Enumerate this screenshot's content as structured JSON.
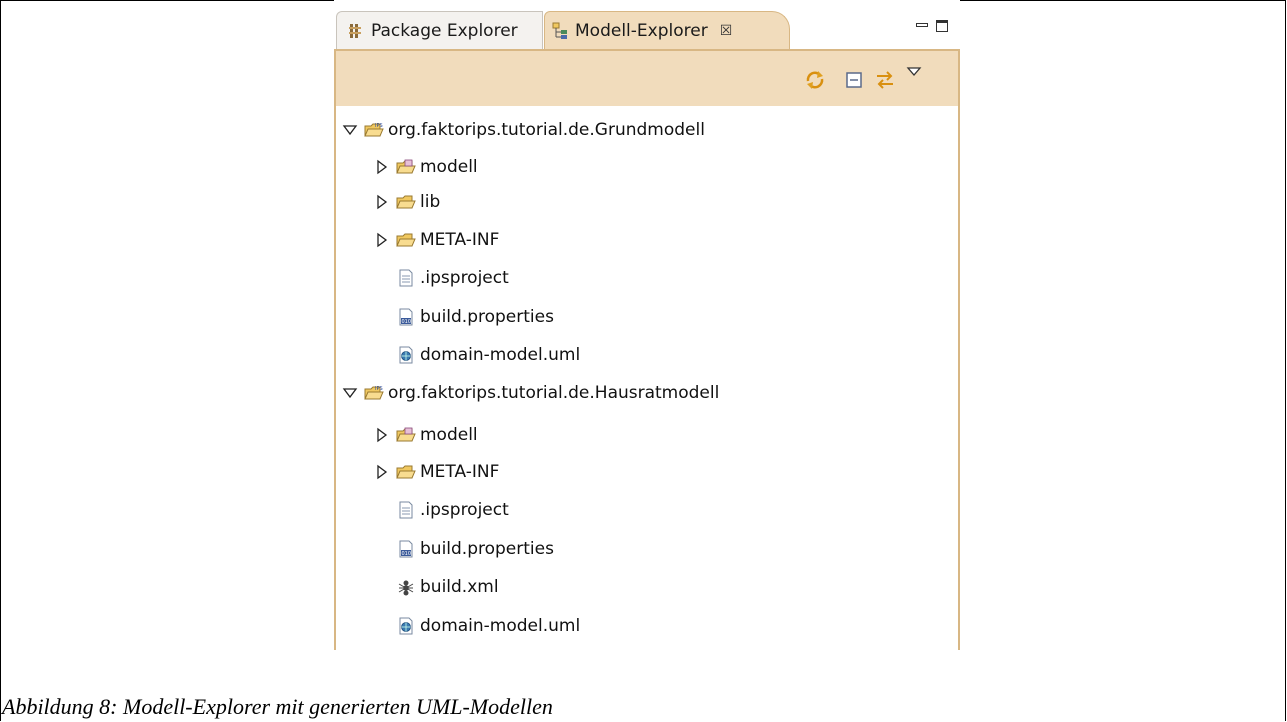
{
  "tabs": [
    {
      "label": "Package Explorer",
      "active": false,
      "icon": "package-explorer-icon"
    },
    {
      "label": "Modell-Explorer",
      "active": true,
      "icon": "modell-explorer-icon",
      "close": "☒"
    }
  ],
  "toolbar": {
    "buttons": [
      "sync-icon",
      "collapse-all-icon",
      "link-with-editor-icon",
      "view-menu-icon"
    ]
  },
  "tree": {
    "projects": [
      {
        "label": "org.faktorips.tutorial.de.Grundmodell",
        "children": [
          {
            "label": "modell",
            "type": "package-folder"
          },
          {
            "label": "lib",
            "type": "folder"
          },
          {
            "label": "META-INF",
            "type": "folder"
          },
          {
            "label": ".ipsproject",
            "type": "text-file"
          },
          {
            "label": "build.properties",
            "type": "properties-file"
          },
          {
            "label": "domain-model.uml",
            "type": "uml-file"
          }
        ]
      },
      {
        "label": "org.faktorips.tutorial.de.Hausratmodell",
        "children": [
          {
            "label": "modell",
            "type": "package-folder"
          },
          {
            "label": "META-INF",
            "type": "folder"
          },
          {
            "label": ".ipsproject",
            "type": "text-file"
          },
          {
            "label": "build.properties",
            "type": "properties-file"
          },
          {
            "label": "build.xml",
            "type": "ant-file"
          },
          {
            "label": "domain-model.uml",
            "type": "uml-file"
          }
        ]
      }
    ]
  },
  "caption": "Abbildung 8: Modell-Explorer mit generierten UML-Modellen",
  "colors": {
    "accent": "#f1dcbc",
    "border": "#d8b784",
    "folder": "#f0c860"
  }
}
